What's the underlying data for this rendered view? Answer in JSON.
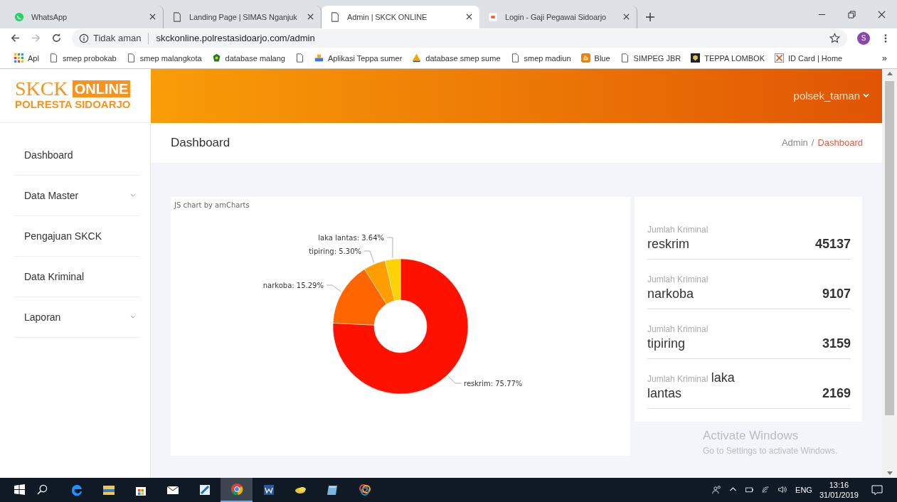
{
  "browser": {
    "tabs": [
      {
        "title": "WhatsApp",
        "kind": "whatsapp",
        "selected": false
      },
      {
        "title": "Landing Page | SIMAS Nganjuk",
        "kind": "page",
        "selected": false
      },
      {
        "title": "Admin | SKCK ONLINE",
        "kind": "page",
        "selected": true
      },
      {
        "title": "Login - Gaji Pegawai Sidoarjo",
        "kind": "favicon",
        "selected": false
      }
    ],
    "security": "Tidak aman",
    "url": "skckonline.polrestasidoarjo.com/admin",
    "avatar": "S",
    "bookmarks": [
      {
        "label": "Apl",
        "kind": "apps"
      },
      {
        "label": "smep probokab",
        "kind": "page"
      },
      {
        "label": "smep malangkota",
        "kind": "page"
      },
      {
        "label": "database malang",
        "kind": "emblem"
      },
      {
        "kind": "page"
      },
      {
        "label": "Aplikasi Teppa sumer",
        "kind": "tray"
      },
      {
        "label": "database smep sume",
        "kind": "pma"
      },
      {
        "label": "smep madiun",
        "kind": "page"
      },
      {
        "label": "Blue",
        "kind": "blogger"
      },
      {
        "label": "SIMPEG JBR",
        "kind": "page"
      },
      {
        "label": "TEPPA LOMBOK",
        "kind": "shield"
      },
      {
        "label": "ID Card | Home",
        "kind": "grid"
      }
    ],
    "bookmarks_overflow": "»"
  },
  "header": {
    "logo": {
      "title": "SKCK",
      "badge": "ONLINE",
      "subtitle": "POLRESTA SIDOARJO"
    },
    "user": "polsek_taman"
  },
  "sidebar": {
    "items": [
      {
        "label": "Dashboard",
        "has_submenu": false
      },
      {
        "label": "Data Master",
        "has_submenu": true
      },
      {
        "label": "Pengajuan SKCK",
        "has_submenu": false
      },
      {
        "label": "Data Kriminal",
        "has_submenu": false
      },
      {
        "label": "Laporan",
        "has_submenu": true
      }
    ]
  },
  "page_title": "Dashboard",
  "breadcrumb": {
    "items": [
      {
        "label": "Admin",
        "current": false
      },
      {
        "label": "Dashboard",
        "current": true
      }
    ],
    "separator": "/"
  },
  "chart_card": {
    "credit": "JS chart by amCharts",
    "chart_data": {
      "type": "donut",
      "categories": [
        "reskrim",
        "narkoba",
        "tipiring",
        "laka lantas"
      ],
      "values": [
        75.77,
        15.29,
        5.3,
        3.64
      ],
      "colors": [
        "#ff1100",
        "#ff6600",
        "#ff9e01",
        "#fcd202"
      ],
      "value_labels": [
        "75.77%",
        "15.29%",
        "5.30%",
        "3.64%"
      ]
    },
    "label_separator": ": "
  },
  "stats": [
    {
      "label": "Jumlah Kriminal",
      "name": "reskrim",
      "value": "45137"
    },
    {
      "label": "Jumlah Kriminal",
      "name": "narkoba",
      "value": "9107"
    },
    {
      "label": "Jumlah Kriminal",
      "name": "tipiring",
      "value": "3159"
    },
    {
      "label": "Jumlah Kriminal",
      "name": "laka lantas",
      "value": "2169"
    }
  ],
  "os_notice": {
    "title": "Activate Windows",
    "text": "Go to Settings to activate Windows."
  },
  "taskbar": {
    "apps": [
      {
        "kind": "edge",
        "selected": false
      },
      {
        "kind": "folder",
        "selected": false
      },
      {
        "kind": "store",
        "selected": false
      },
      {
        "kind": "mail",
        "selected": false
      },
      {
        "kind": "pen",
        "selected": false
      },
      {
        "kind": "chrome",
        "selected": true
      },
      {
        "kind": "word",
        "selected": false
      },
      {
        "kind": "coins",
        "selected": false
      },
      {
        "kind": "notebook",
        "selected": false
      },
      {
        "kind": "rings",
        "selected": false
      }
    ],
    "language": "ENG",
    "time": "13:16",
    "date": "31/01/2019"
  }
}
